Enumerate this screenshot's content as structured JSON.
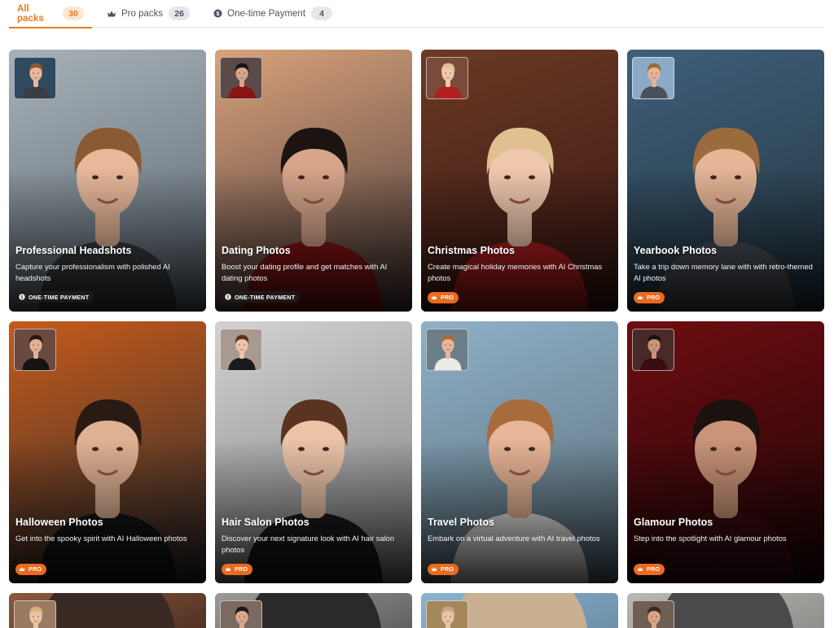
{
  "tabs": [
    {
      "label": "All packs",
      "count": "30",
      "icon": "none"
    },
    {
      "label": "Pro packs",
      "count": "26",
      "icon": "crown-icon"
    },
    {
      "label": "One-time Payment",
      "count": "4",
      "icon": "coin-icon"
    }
  ],
  "packs": [
    {
      "title": "Professional Headshots",
      "description": "Capture your professionalism with polished AI headshots",
      "badge": "ONE-TIME PAYMENT",
      "badge_type": "otp",
      "colors": {
        "bg_top": "#a7b1b8",
        "bg_bottom": "#5b6670",
        "hair": "#8a5a34",
        "skin": "#e8b89a",
        "cloth": "#3a3d42",
        "thumb_bg": "#2f4a5e"
      }
    },
    {
      "title": "Dating Photos",
      "description": "Boost your dating profile and get matches with AI dating photos",
      "badge": "ONE-TIME PAYMENT",
      "badge_type": "otp",
      "colors": {
        "bg_top": "#d9a27a",
        "bg_bottom": "#4a3a3a",
        "hair": "#1b1412",
        "skin": "#d6a58a",
        "cloth": "#8a1414",
        "thumb_bg": "#5a4a48"
      }
    },
    {
      "title": "Christmas Photos",
      "description": "Create magical holiday memories with AI Christmas photos",
      "badge": "PRO",
      "badge_type": "pro",
      "colors": {
        "bg_top": "#6a3a24",
        "bg_bottom": "#3a1612",
        "hair": "#e0c090",
        "skin": "#f0c8ae",
        "cloth": "#b51e1e",
        "thumb_bg": "#7a4a3a"
      }
    },
    {
      "title": "Yearbook Photos",
      "description": "Take a trip down memory lane with with retro-themed AI photos",
      "badge": "PRO",
      "badge_type": "pro",
      "colors": {
        "bg_top": "#3f5f7a",
        "bg_bottom": "#22343f",
        "hair": "#9c6b3d",
        "skin": "#e5b595",
        "cloth": "#4a4f58",
        "thumb_bg": "#8aaac8"
      }
    },
    {
      "title": "Halloween Photos",
      "description": "Get into the spooky spirit with AI Halloween photos",
      "badge": "PRO",
      "badge_type": "pro",
      "colors": {
        "bg_top": "#c65a1a",
        "bg_bottom": "#2b2b2e",
        "hair": "#2a1a14",
        "skin": "#e0b295",
        "cloth": "#141414",
        "thumb_bg": "#6a4a40"
      }
    },
    {
      "title": "Hair Salon Photos",
      "description": "Discover your next signature look with AI hair salon photos",
      "badge": "PRO",
      "badge_type": "pro",
      "colors": {
        "bg_top": "#d2d2d2",
        "bg_bottom": "#7e7e80",
        "hair": "#5a3420",
        "skin": "#ecc4a8",
        "cloth": "#1b1b1d",
        "thumb_bg": "#a89a90"
      }
    },
    {
      "title": "Travel Photos",
      "description": "Embark on a virtual adventure with AI travel photos",
      "badge": "PRO",
      "badge_type": "pro",
      "colors": {
        "bg_top": "#8fb0c8",
        "bg_bottom": "#5a6e78",
        "hair": "#a86c3c",
        "skin": "#e7b597",
        "cloth": "#eceae6",
        "thumb_bg": "#6c7e88"
      }
    },
    {
      "title": "Glamour Photos",
      "description": "Step into the spotlight with AI glamour photos",
      "badge": "PRO",
      "badge_type": "pro",
      "colors": {
        "bg_top": "#6e0d10",
        "bg_bottom": "#1e0507",
        "hair": "#1b1210",
        "skin": "#c99478",
        "cloth": "#3a0c14",
        "thumb_bg": "#4a2a28"
      }
    },
    {
      "title": "",
      "description": "",
      "badge": "",
      "badge_type": "",
      "colors": {
        "bg_top": "#8a5a3c",
        "bg_bottom": "#4a2c20",
        "hair": "#d8b07a",
        "skin": "#eac2a6",
        "cloth": "#3a2a24",
        "thumb_bg": "#9a7a60"
      }
    },
    {
      "title": "",
      "description": "",
      "badge": "",
      "badge_type": "",
      "colors": {
        "bg_top": "#9a9a9a",
        "bg_bottom": "#5a5a5a",
        "hair": "#1a1a1a",
        "skin": "#d9a88c",
        "cloth": "#2a2a2a",
        "thumb_bg": "#7a6a60"
      }
    },
    {
      "title": "",
      "description": "",
      "badge": "",
      "badge_type": "",
      "colors": {
        "bg_top": "#8ab4d2",
        "bg_bottom": "#6a8aa4",
        "hair": "#c8a878",
        "skin": "#eac4a8",
        "cloth": "#c8b090",
        "thumb_bg": "#a4885c"
      }
    },
    {
      "title": "",
      "description": "",
      "badge": "",
      "badge_type": "",
      "colors": {
        "bg_top": "#b8b8b4",
        "bg_bottom": "#8a8a88",
        "hair": "#3a2a22",
        "skin": "#d7a58a",
        "cloth": "#4a4a4a",
        "thumb_bg": "#6e5e54"
      }
    }
  ]
}
